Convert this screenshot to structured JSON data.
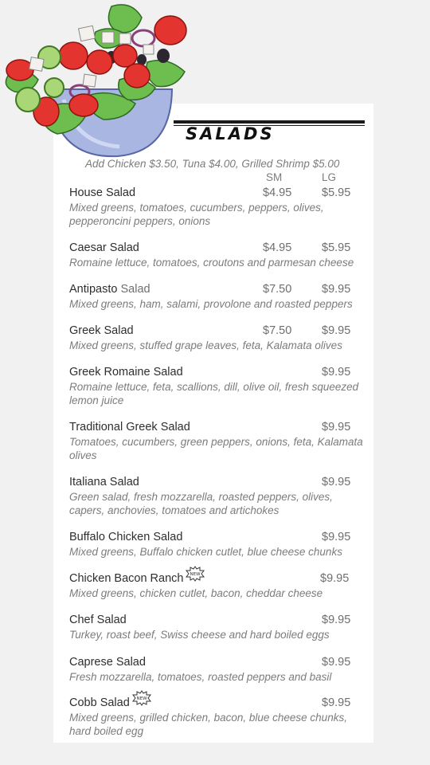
{
  "menu": {
    "title": "SALADS",
    "addons": "Add Chicken $3.50, Tuna $4.00, Grilled Shrimp $5.00",
    "size_sm": "SM",
    "size_lg": "LG",
    "new_badge": "NEW"
  },
  "items": [
    {
      "name": "House Salad",
      "sm": "$4.95",
      "lg": "$5.95",
      "desc": "Mixed greens, tomatoes, cucumbers, peppers, olives, pepperoncini peppers, onions"
    },
    {
      "name": "Caesar Salad",
      "sm": "$4.95",
      "lg": "$5.95",
      "desc": "Romaine lettuce, tomatoes, croutons and parmesan cheese"
    },
    {
      "name": "Antipasto",
      "name_suffix": "Salad",
      "sm": "$7.50",
      "lg": "$9.95",
      "desc": "Mixed greens, ham, salami, provolone and roasted peppers"
    },
    {
      "name": "Greek Salad",
      "sm": "$7.50",
      "lg": "$9.95",
      "desc": "Mixed greens, stuffed grape leaves, feta, Kalamata olives"
    },
    {
      "name": "Greek Romaine Salad",
      "lg": "$9.95",
      "desc": "Romaine lettuce, feta, scallions, dill, olive oil, fresh squeezed lemon juice"
    },
    {
      "name": "Traditional Greek Salad",
      "lg": "$9.95",
      "desc": "Tomatoes, cucumbers, green peppers, onions, feta, Kalamata olives"
    },
    {
      "name": "Italiana Salad",
      "lg": "$9.95",
      "desc": "Green salad, fresh mozzarella, roasted peppers, olives, capers, anchovies, tomatoes and artichokes"
    },
    {
      "name": "Buffalo Chicken Salad",
      "lg": "$9.95",
      "desc": "Mixed greens, Buffalo chicken cutlet, blue cheese chunks"
    },
    {
      "name": "Chicken Bacon Ranch",
      "lg": "$9.95",
      "is_new": true,
      "desc": "Mixed greens, chicken cutlet, bacon, cheddar cheese"
    },
    {
      "name": "Chef Salad",
      "lg": "$9.95",
      "desc": "Turkey, roast beef, Swiss cheese and hard boiled eggs"
    },
    {
      "name": "Caprese Salad",
      "lg": "$9.95",
      "desc": "Fresh mozzarella, tomatoes, roasted peppers and basil"
    },
    {
      "name": "Cobb Salad",
      "lg": "$9.95",
      "is_new": true,
      "desc": "Mixed greens, grilled chicken, bacon, blue cheese chunks, hard boiled egg"
    }
  ]
}
